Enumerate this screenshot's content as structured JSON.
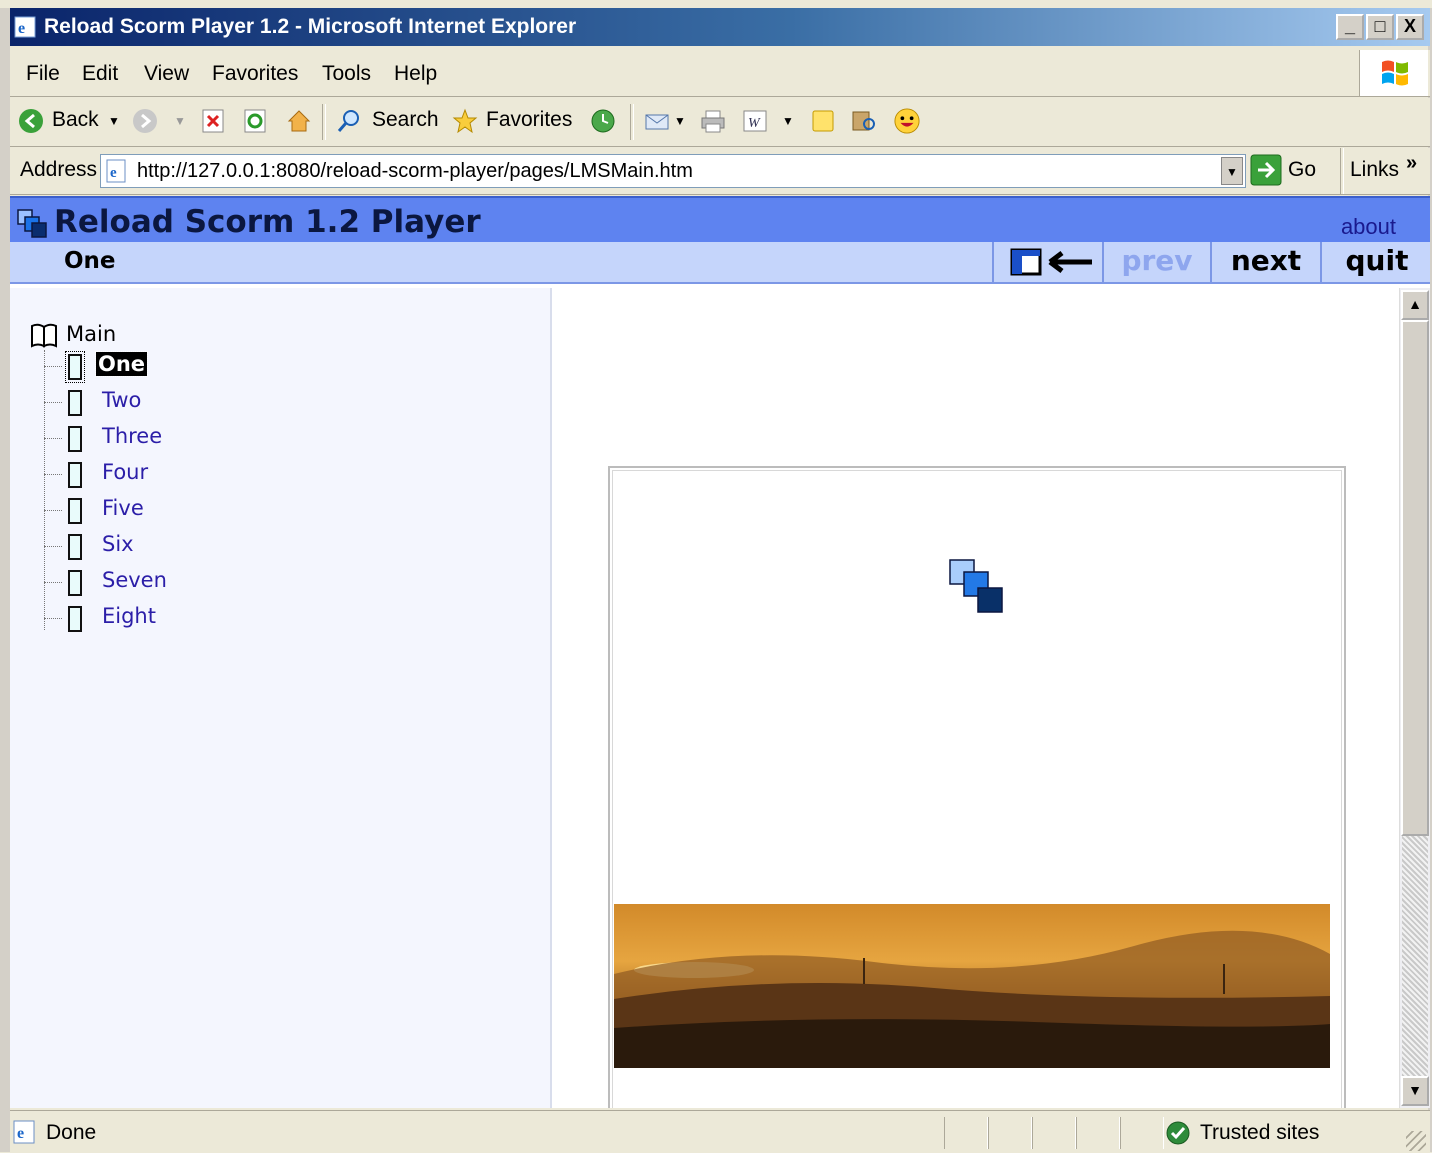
{
  "window": {
    "title": "Reload Scorm Player 1.2 - Microsoft Internet Explorer",
    "minimize_glyph": "_",
    "maximize_glyph": "□",
    "close_glyph": "X"
  },
  "menu": {
    "items": [
      "File",
      "Edit",
      "View",
      "Favorites",
      "Tools",
      "Help"
    ]
  },
  "toolbar": {
    "back_label": "Back",
    "search_label": "Search",
    "favorites_label": "Favorites"
  },
  "address": {
    "label": "Address",
    "url": "http://127.0.0.1:8080/reload-scorm-player/pages/LMSMain.htm",
    "go_label": "Go",
    "links_label": "Links",
    "chevron": "»"
  },
  "player": {
    "title": "Reload Scorm 1.2 Player",
    "about_label": "about",
    "current_item": "One",
    "prev_label": "prev",
    "next_label": "next",
    "quit_label": "quit"
  },
  "tree": {
    "root_label": "Main",
    "items": [
      "One",
      "Two",
      "Three",
      "Four",
      "Five",
      "Six",
      "Seven",
      "Eight"
    ],
    "selected_index": 0
  },
  "status": {
    "text": "Done",
    "zone": "Trusted sites"
  },
  "colors": {
    "header_blue": "#5e83f0",
    "nav_light_blue": "#c5d5fb",
    "link_purple": "#2b1ea8"
  }
}
